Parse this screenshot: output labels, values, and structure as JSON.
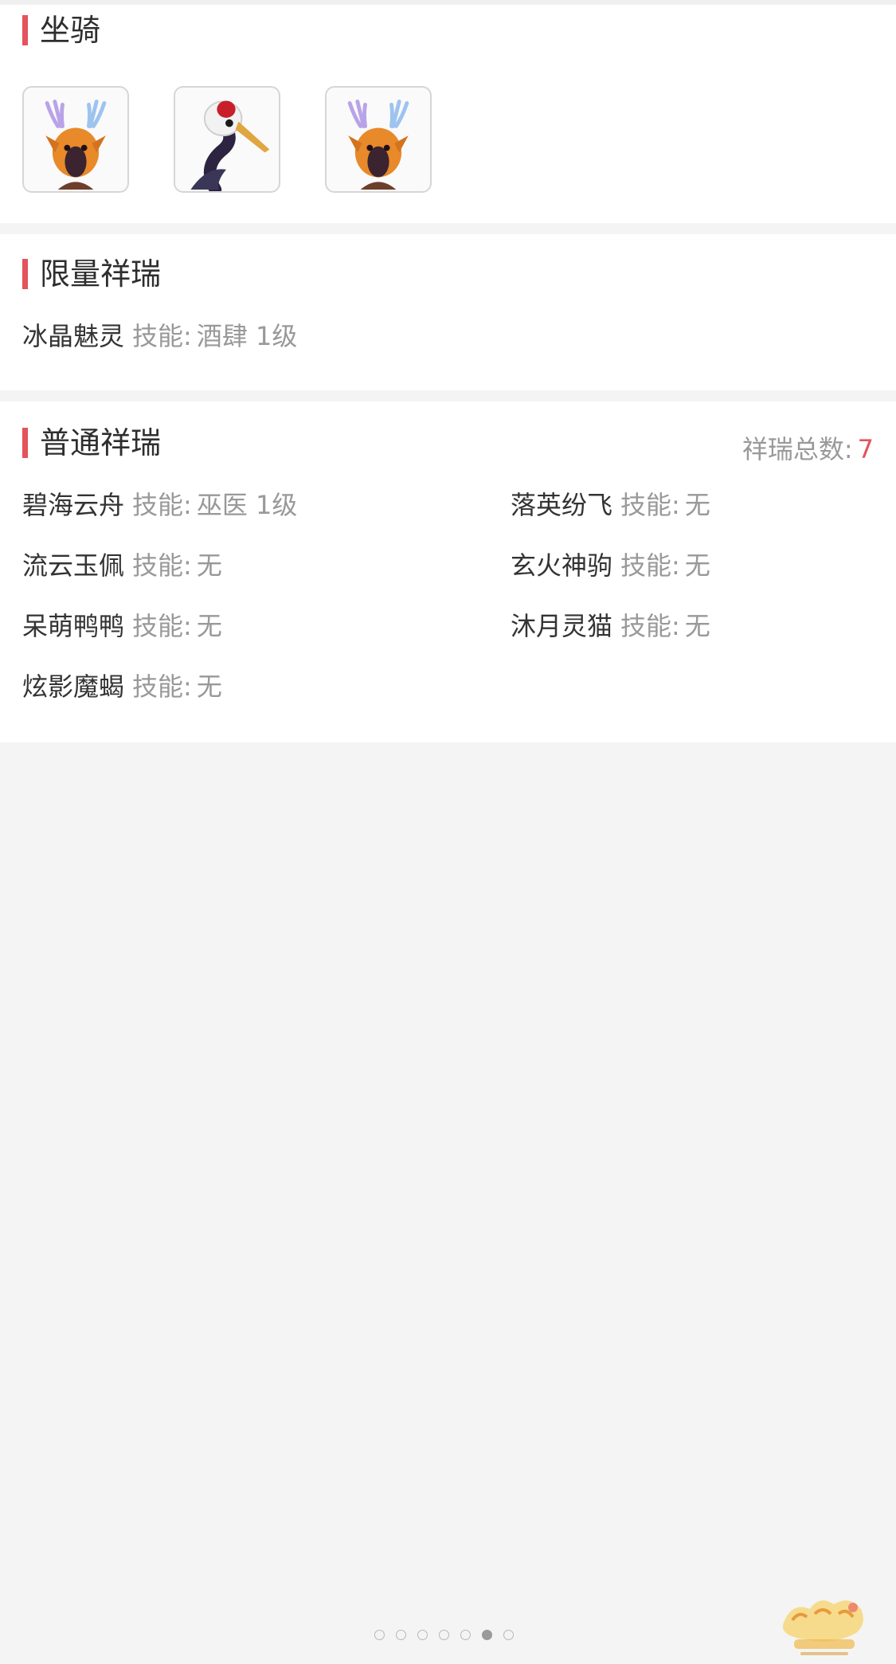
{
  "mounts": {
    "title": "坐骑",
    "items": [
      {
        "icon": "deer-mount-icon"
      },
      {
        "icon": "crane-mount-icon"
      },
      {
        "icon": "deer-mount-icon"
      }
    ]
  },
  "limited": {
    "title": "限量祥瑞",
    "items": [
      {
        "name": "冰晶魅灵",
        "skill_label": "技能:",
        "skill": "酒肆 1级"
      }
    ]
  },
  "normal": {
    "title": "普通祥瑞",
    "total_label": "祥瑞总数:",
    "total": "7",
    "items": [
      {
        "name": "碧海云舟",
        "skill_label": "技能:",
        "skill": "巫医 1级"
      },
      {
        "name": "落英纷飞",
        "skill_label": "技能:",
        "skill": "无"
      },
      {
        "name": "流云玉佩",
        "skill_label": "技能:",
        "skill": "无"
      },
      {
        "name": "玄火神驹",
        "skill_label": "技能:",
        "skill": "无"
      },
      {
        "name": "呆萌鸭鸭",
        "skill_label": "技能:",
        "skill": "无"
      },
      {
        "name": "沐月灵猫",
        "skill_label": "技能:",
        "skill": "无"
      },
      {
        "name": "炫影魔蝎",
        "skill_label": "技能:",
        "skill": "无"
      }
    ]
  },
  "pager": {
    "count": 7,
    "active_index": 5
  },
  "colors": {
    "accent": "#e3545c",
    "text": "#333333",
    "muted": "#999999",
    "background": "#f4f4f4"
  }
}
